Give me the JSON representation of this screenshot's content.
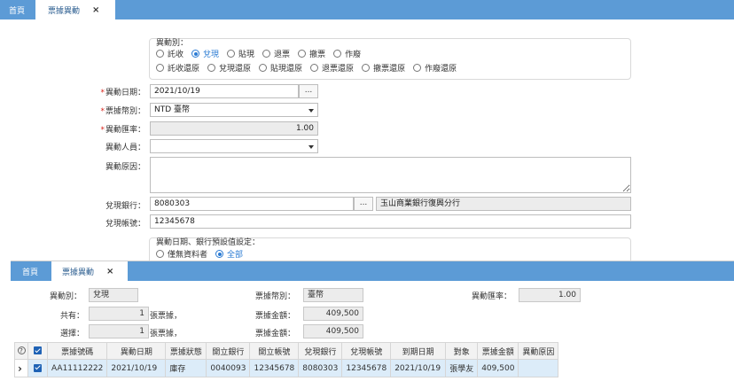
{
  "top_tabs": [
    {
      "label": "首頁"
    },
    {
      "label": "票據異動",
      "close": "×"
    }
  ],
  "form": {
    "change_type": {
      "label": "異動別：",
      "row1": [
        {
          "label": "託收",
          "checked": false
        },
        {
          "label": "兌現",
          "checked": true
        },
        {
          "label": "貼現",
          "checked": false
        },
        {
          "label": "退票",
          "checked": false
        },
        {
          "label": "撤票",
          "checked": false
        },
        {
          "label": "作廢",
          "checked": false
        }
      ],
      "row2": [
        {
          "label": "託收還原",
          "checked": false
        },
        {
          "label": "兌現還原",
          "checked": false
        },
        {
          "label": "貼現還原",
          "checked": false
        },
        {
          "label": "退票還原",
          "checked": false
        },
        {
          "label": "撤票還原",
          "checked": false
        },
        {
          "label": "作廢還原",
          "checked": false
        }
      ]
    },
    "change_date": {
      "required_mark": "*",
      "label": "異動日期：",
      "value": "2021/10/19",
      "button": "..."
    },
    "currency": {
      "required_mark": "*",
      "label": "票據幣別：",
      "value": "NTD 臺幣"
    },
    "exchange_rate": {
      "required_mark": "*",
      "label": "異動匯率：",
      "value": "1.00"
    },
    "staff": {
      "label": "異動人員：",
      "value": ""
    },
    "reason": {
      "label": "異動原因：",
      "value": ""
    },
    "bank": {
      "label": "兌現銀行：",
      "value": "8080303",
      "button": "...",
      "name": "玉山商業銀行復興分行"
    },
    "account": {
      "label": "兌現帳號：",
      "value": "12345678"
    },
    "default_setting": {
      "label": "異動日期、銀行預設值設定：",
      "options": [
        {
          "label": "僅無資料者",
          "checked": false
        },
        {
          "label": "全部",
          "checked": true
        }
      ]
    }
  },
  "bottom_tabs": [
    {
      "label": "首頁"
    },
    {
      "label": "票據異動",
      "close": "×"
    }
  ],
  "summary": {
    "change_type_label": "異動別：",
    "change_type_value": "兌現",
    "currency_label": "票據幣別：",
    "currency_value": "臺幣",
    "rate_label": "異動匯率：",
    "rate_value": "1.00",
    "total_label": "共有：",
    "total_value": "1",
    "total_unit": "張票據，",
    "total_amount_label": "票據金額：",
    "total_amount_value": "409,500",
    "selected_label": "選擇：",
    "selected_value": "1",
    "selected_unit": "張票據，",
    "selected_amount_label": "票據金額：",
    "selected_amount_value": "409,500"
  },
  "grid": {
    "help": "?",
    "columns": [
      "票據號碼",
      "異動日期",
      "票據狀態",
      "開立銀行",
      "開立帳號",
      "兌現銀行",
      "兌現帳號",
      "到期日期",
      "對象",
      "票據金額",
      "異動原因"
    ],
    "rows": [
      {
        "indicator": "›",
        "checked": true,
        "cells": [
          "AA11112222",
          "2021/10/19",
          "庫存",
          "0040093",
          "12345678",
          "8080303",
          "12345678",
          "2021/10/19",
          "張學友",
          "409,500",
          ""
        ]
      }
    ]
  },
  "colors": {
    "tabbar": "#5c9bd6",
    "accent": "#2b7bd3",
    "required": "#d9251c",
    "selected_row": "#dcecf9"
  }
}
